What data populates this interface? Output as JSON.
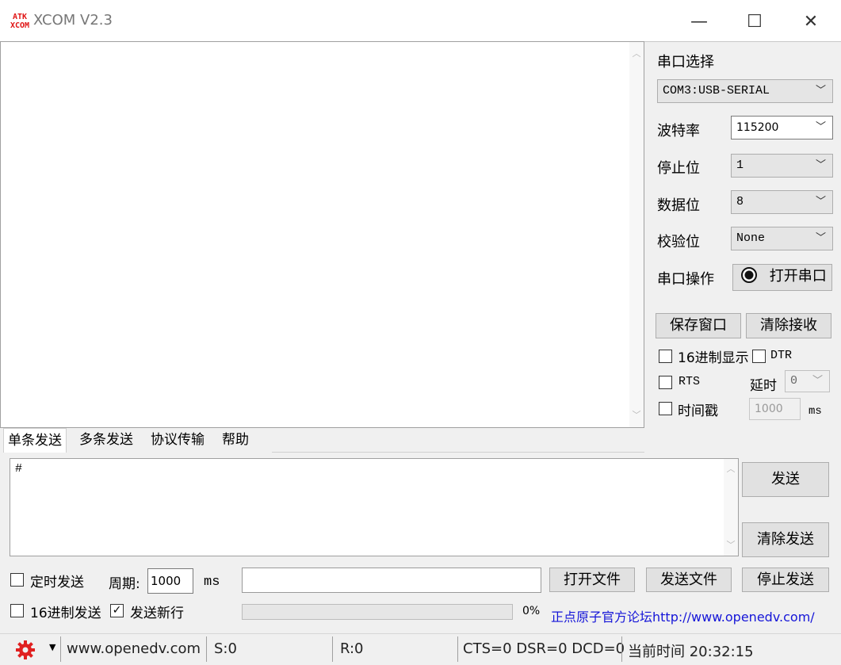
{
  "window": {
    "logo_top": "ATK",
    "logo_bottom": "XCOM",
    "title": "XCOM V2.3",
    "minimize_glyph": "—",
    "maximize_glyph": "☐",
    "close_glyph": "✕"
  },
  "receive_area": {
    "text": ""
  },
  "serial": {
    "port_label": "串口选择",
    "port_value": "COM3:USB-SERIAL",
    "baud_label": "波特率",
    "baud_value": "115200",
    "stop_label": "停止位",
    "stop_value": "1",
    "data_label": "数据位",
    "data_value": "8",
    "parity_label": "校验位",
    "parity_value": "None",
    "op_label": "串口操作",
    "open_button": "打开串口"
  },
  "actions": {
    "save_window": "保存窗口",
    "clear_receive": "清除接收"
  },
  "options": {
    "hex_display": "16进制显示",
    "hex_display_checked": false,
    "dtr": "DTR",
    "dtr_checked": false,
    "rts": "RTS",
    "rts_checked": false,
    "delay_label": "延时",
    "delay_value": "0",
    "timestamp": "时间戳",
    "timestamp_checked": false,
    "timestamp_value": "1000",
    "timestamp_unit": "ms"
  },
  "tabs": [
    "单条发送",
    "多条发送",
    "协议传输",
    "帮助"
  ],
  "selected_tab": "单条发送",
  "send_area": {
    "text": "#"
  },
  "send": {
    "send_button": "发送",
    "clear_send_button": "清除发送",
    "timed_send": "定时发送",
    "timed_send_checked": false,
    "period_label": "周期:",
    "period_value": "1000",
    "period_unit": "ms",
    "file_path": "",
    "open_file": "打开文件",
    "send_file": "发送文件",
    "stop_send": "停止发送",
    "hex_send": "16进制发送",
    "hex_send_checked": false,
    "send_newline": "发送新行",
    "send_newline_checked": true,
    "progress_percent": "0%",
    "progress_fraction": 0,
    "forum_link": "正点原子官方论坛http://www.openedv.com/"
  },
  "status": {
    "url": "www.openedv.com",
    "sent": "S:0",
    "received": "R:0",
    "lines": "CTS=0 DSR=0 DCD=0",
    "time": "当前时间 20:32:15"
  },
  "colors": {
    "logo_red": "#e01515",
    "gear_red": "#e02020",
    "link_blue": "#1515d8",
    "frame_gray": "#f0f0f0"
  },
  "icons": {
    "gear": "gear-icon",
    "dropdown": "chevron-down-icon",
    "radio": "radio-dot-icon"
  }
}
